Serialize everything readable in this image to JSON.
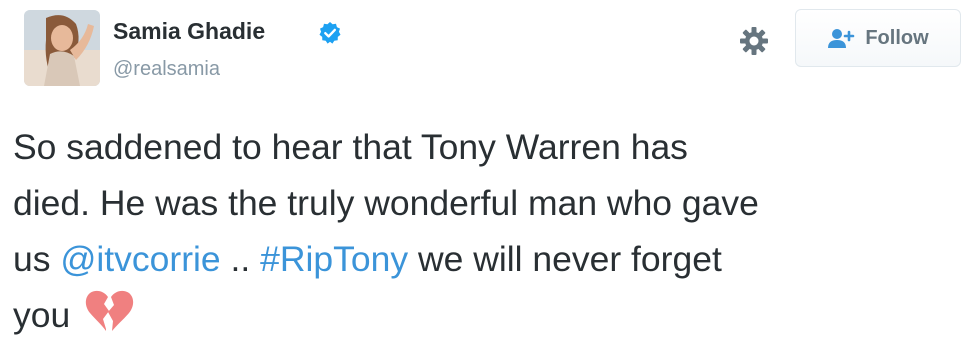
{
  "user": {
    "display_name": "Samia Ghadie",
    "handle": "@realsamia",
    "verified": true
  },
  "actions": {
    "settings_icon": "gear-icon",
    "follow_label": "Follow",
    "follow_icon": "add-user-icon"
  },
  "tweet": {
    "line1": "So saddened to hear that Tony Warren has",
    "line2": "died. He was the truly wonderful man who gave",
    "line3_prefix": "us ",
    "mention": "@itvcorrie",
    "line3_mid": " .. ",
    "hashtag": "#RipTony",
    "line3_suffix": " we will never forget",
    "line4": "you",
    "emoji": "broken-heart-icon"
  },
  "colors": {
    "text": "#292f33",
    "link": "#3b94d9",
    "handle": "#8899a6",
    "verified_badge": "#1da1f2",
    "broken_heart": "#f08080"
  }
}
